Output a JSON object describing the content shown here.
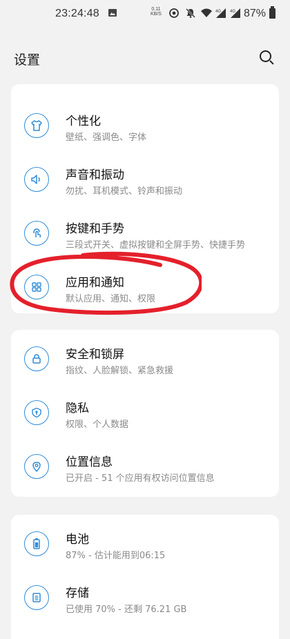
{
  "status_bar": {
    "time": "23:24:48",
    "net_speed_value": "0.11",
    "net_speed_unit": "KB/S",
    "battery": "87%",
    "icons": [
      "image-icon",
      "hotspot-icon",
      "mute-icon",
      "wifi-icon",
      "signal-4g-icon",
      "signal-4g-icon",
      "battery-icon"
    ]
  },
  "header": {
    "title": "设置",
    "search_icon": "search-icon"
  },
  "groups": [
    {
      "items": [
        {
          "title": "个性化",
          "subtitle": "壁纸、强调色、字体",
          "icon": "tshirt-icon"
        },
        {
          "title": "声音和振动",
          "subtitle": "勿扰、耳机模式、铃声和振动",
          "icon": "speaker-icon"
        },
        {
          "title": "按键和手势",
          "subtitle": "三段式开关、虚拟按键和全屏手势、快捷手势",
          "icon": "gesture-icon"
        },
        {
          "title": "应用和通知",
          "subtitle": "默认应用、通知、权限",
          "icon": "apps-grid-icon"
        }
      ]
    },
    {
      "items": [
        {
          "title": "安全和锁屏",
          "subtitle": "指纹、人脸解锁、紧急救援",
          "icon": "lock-icon"
        },
        {
          "title": "隐私",
          "subtitle": "权限、个人数据",
          "icon": "privacy-shield-icon"
        },
        {
          "title": "位置信息",
          "subtitle": "已开启 - 51 个应用有权访问位置信息",
          "icon": "location-pin-icon"
        }
      ]
    },
    {
      "items": [
        {
          "title": "电池",
          "subtitle": "87% - 估计能用到06:15",
          "icon": "battery-icon"
        },
        {
          "title": "存储",
          "subtitle": "已使用 70% - 还剩 76.21 GB",
          "icon": "storage-icon"
        }
      ]
    }
  ],
  "annotation_color": "#e4202b",
  "accent_color": "#2f8cd9"
}
